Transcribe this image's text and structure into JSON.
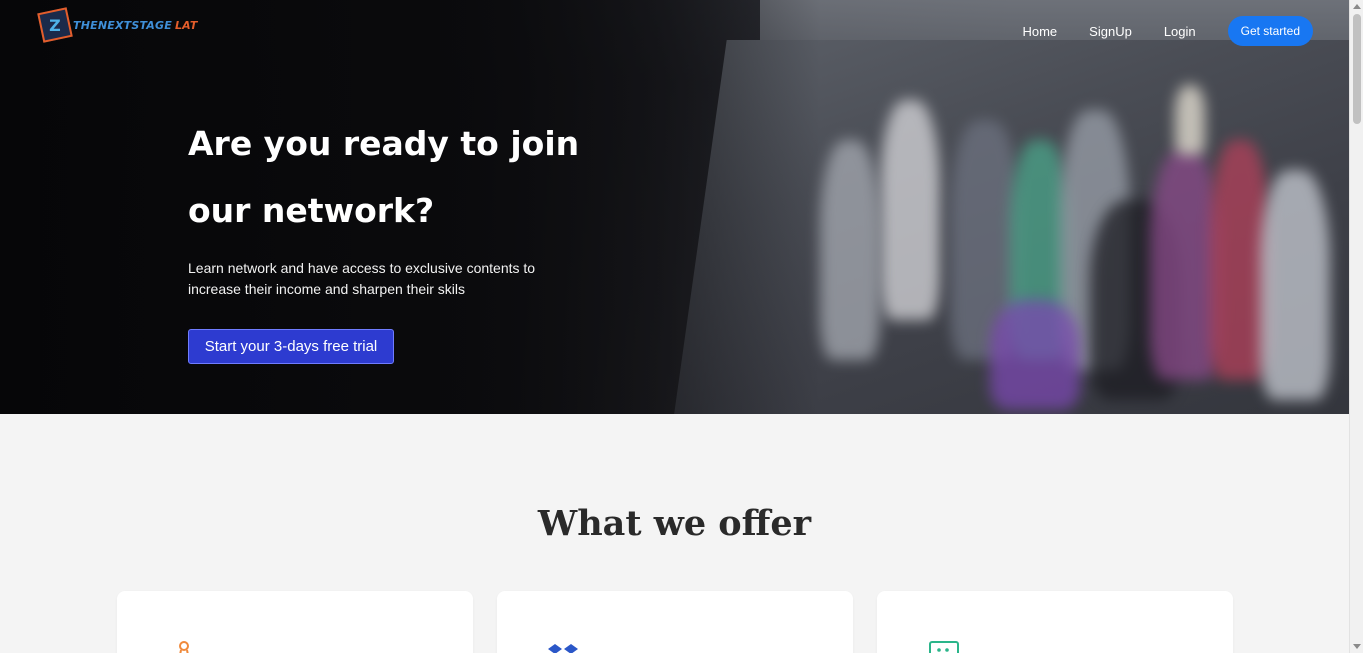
{
  "brand": {
    "name_part1": "THENEXTSTAGE",
    "name_part2": "LAT"
  },
  "nav": {
    "home": "Home",
    "signup": "SignUp",
    "login": "Login",
    "cta": "Get started"
  },
  "hero": {
    "title_line1": "Are you ready to join",
    "title_line2": "our network?",
    "subtitle": "Learn network and have access to exclusive contents to increase their income and sharpen their skils",
    "button": "Start your 3-days free trial"
  },
  "offer": {
    "title": "What we offer",
    "cards": [
      {
        "icon": "award-icon",
        "color": "#f08a3c"
      },
      {
        "icon": "dropbox-icon",
        "color": "#2b57c8"
      },
      {
        "icon": "chat-icon",
        "color": "#2bb58a"
      }
    ]
  },
  "colors": {
    "accent": "#1877f2",
    "trial_button": "#2d3bd0",
    "brand_orange": "#e35d2b",
    "brand_blue": "#3f8fd8"
  }
}
